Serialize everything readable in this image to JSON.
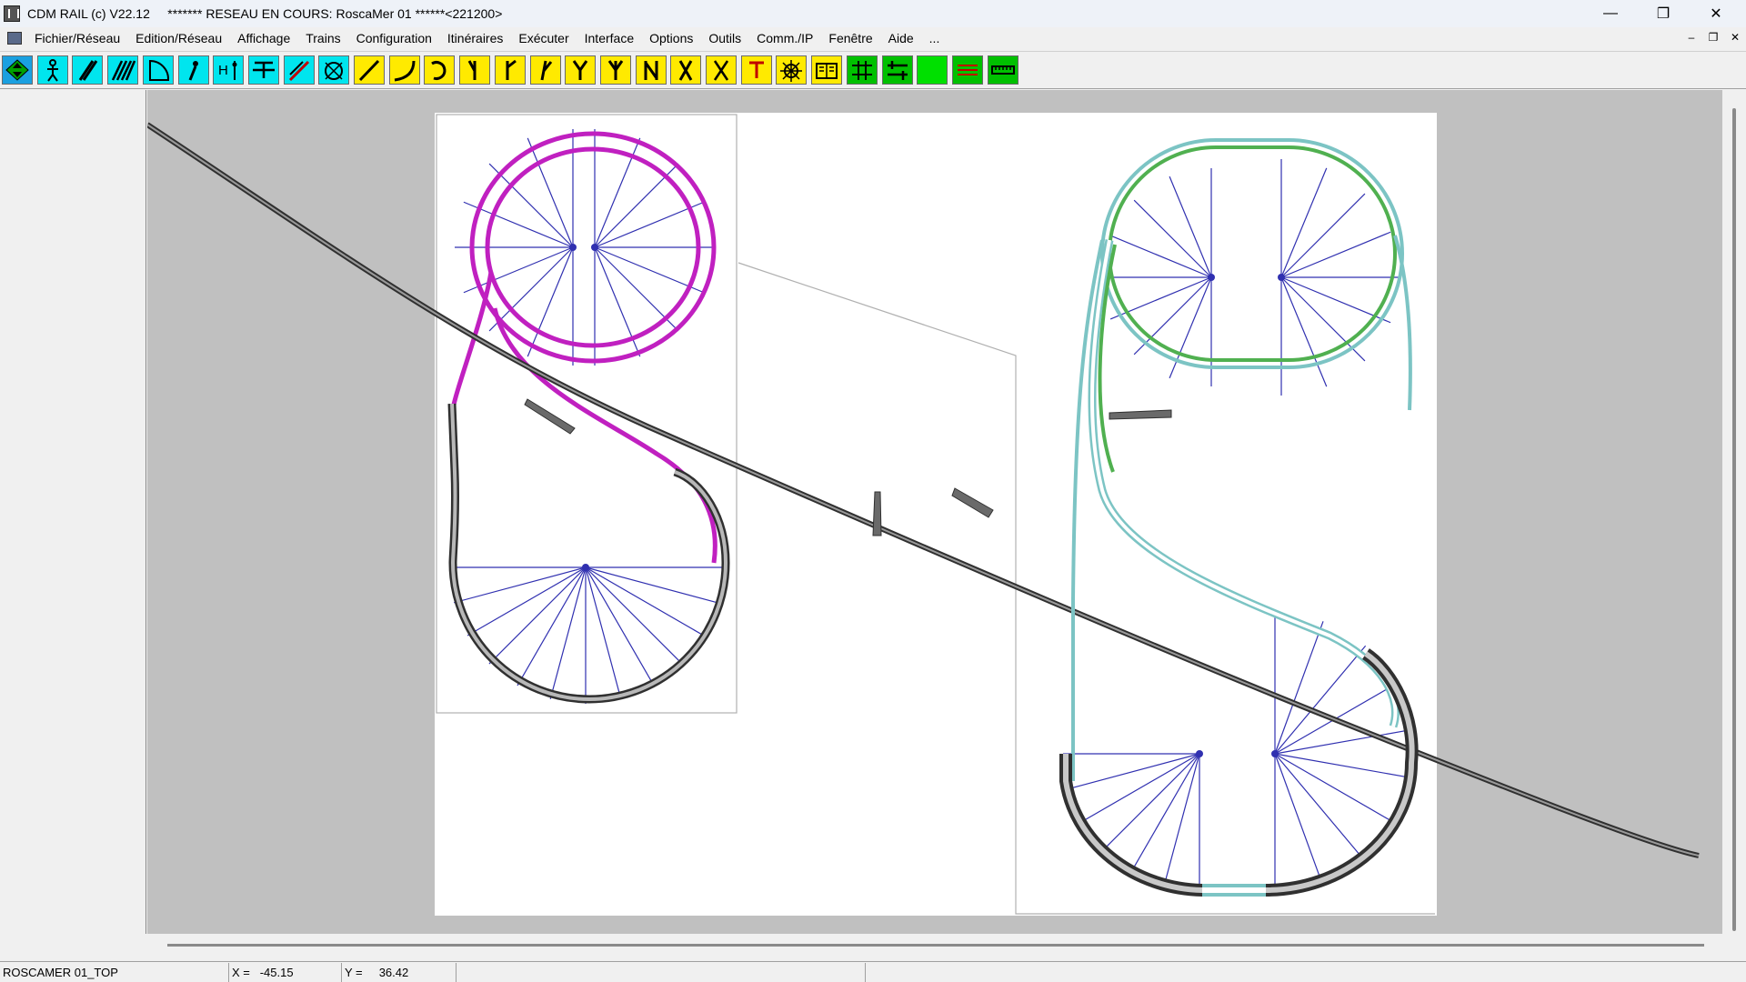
{
  "titlebar": {
    "title": "CDM RAIL (c) V22.12     ******* RESEAU EN COURS: RoscaMer 01 ******<221200>",
    "minimize": "—",
    "restore": "❐",
    "close": "✕"
  },
  "menubar": {
    "items": [
      "Fichier/Réseau",
      "Edition/Réseau",
      "Affichage",
      "Trains",
      "Configuration",
      "Itinéraires",
      "Exécuter",
      "Interface",
      "Options",
      "Outils",
      "Comm./IP",
      "Fenêtre",
      "Aide",
      "..."
    ],
    "mdi_minimize": "–",
    "mdi_restore": "❐",
    "mdi_close": "✕"
  },
  "toolbar": {
    "buttons": [
      {
        "icon": "diamond-arrows-icon",
        "bg": "#1aa0e0"
      },
      {
        "icon": "person-icon",
        "bg": "#00e5ee"
      },
      {
        "icon": "diagonal-track-icon",
        "bg": "#00e5ee"
      },
      {
        "icon": "double-diagonal-icon",
        "bg": "#00e5ee"
      },
      {
        "icon": "curve-corner-icon",
        "bg": "#00e5ee"
      },
      {
        "icon": "pin-icon",
        "bg": "#00e5ee"
      },
      {
        "icon": "h-signal-icon",
        "bg": "#00e5ee"
      },
      {
        "icon": "buffer-stop-icon",
        "bg": "#00e5ee"
      },
      {
        "icon": "ruler-pencil-icon",
        "bg": "#00e5ee"
      },
      {
        "icon": "turntable-icon",
        "bg": "#00e5ee"
      },
      {
        "icon": "straight-track-icon",
        "bg": "#ffea00"
      },
      {
        "icon": "curved-track-icon",
        "bg": "#ffea00"
      },
      {
        "icon": "loop-track-icon",
        "bg": "#ffea00"
      },
      {
        "icon": "turnout-left-icon",
        "bg": "#ffea00"
      },
      {
        "icon": "turnout-right-icon",
        "bg": "#ffea00"
      },
      {
        "icon": "curved-turnout-icon",
        "bg": "#ffea00"
      },
      {
        "icon": "y-turnout-icon",
        "bg": "#ffea00"
      },
      {
        "icon": "three-way-turnout-icon",
        "bg": "#ffea00"
      },
      {
        "icon": "double-slip-icon",
        "bg": "#ffea00"
      },
      {
        "icon": "single-slip-icon",
        "bg": "#ffea00"
      },
      {
        "icon": "crossing-icon",
        "bg": "#ffea00"
      },
      {
        "icon": "t-track-icon",
        "bg": "#ffea00"
      },
      {
        "icon": "turntable-yard-icon",
        "bg": "#ffea00"
      },
      {
        "icon": "book-icon",
        "bg": "#ffea00"
      },
      {
        "icon": "signal-panel-icon",
        "bg": "#00c000"
      },
      {
        "icon": "signal-panel-alt-icon",
        "bg": "#00c000"
      },
      {
        "icon": "green-block-icon",
        "bg": "#00e000"
      },
      {
        "icon": "lines-icon",
        "bg": "#00c000"
      },
      {
        "icon": "ruler-icon",
        "bg": "#00c000"
      }
    ]
  },
  "statusbar": {
    "layer": "ROSCAMER 01_TOP",
    "x_label": "X =",
    "x_value": "-45.15",
    "y_label": "Y =",
    "y_value": "36.42"
  },
  "colors": {
    "track_gray": "#505050",
    "track_magenta": "#c020c0",
    "track_green": "#50b050",
    "track_teal": "#7cc4c4",
    "guide_blue": "#3030b0",
    "canvas_bg": "#c0c0c0"
  }
}
